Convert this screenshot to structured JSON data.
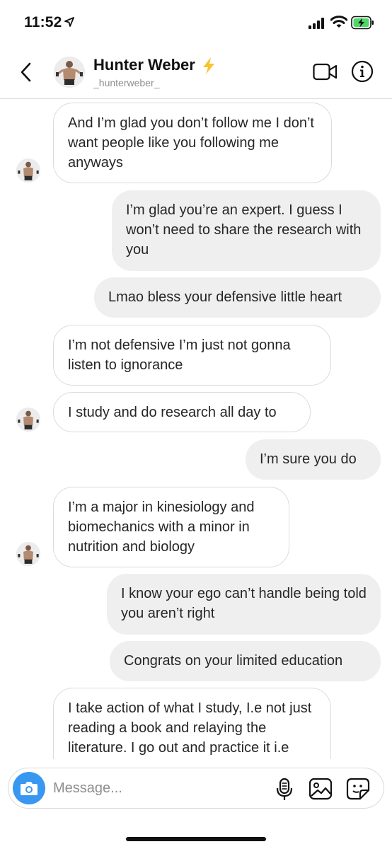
{
  "status_bar": {
    "time": "11:52"
  },
  "header": {
    "name": "Hunter Weber",
    "username": "_hunterweber_",
    "icons": [
      "back-chevron-icon",
      "bolt-icon",
      "video-camera-icon",
      "info-icon"
    ]
  },
  "messages": [
    {
      "from": "them",
      "text": "And I’m glad you don’t follow me I don’t want people like you following me anyways"
    },
    {
      "from": "me",
      "text": "I’m glad you’re an expert. I guess I won’t need to share the research with you"
    },
    {
      "from": "me",
      "text": "Lmao bless your defensive little heart"
    },
    {
      "from": "them",
      "text": "I’m not defensive I’m just not gonna listen to ignorance"
    },
    {
      "from": "them",
      "text": "I study and do research all day to"
    },
    {
      "from": "me",
      "text": "I’m sure you do"
    },
    {
      "from": "them",
      "text": "I’m a major in kinesiology and biomechanics with a minor in nutrition and biology"
    },
    {
      "from": "me",
      "text": "I know your ego can’t handle being told you aren’t right"
    },
    {
      "from": "me",
      "text": "Congrats on your limited education"
    },
    {
      "from": "them",
      "text": "I take action of what I study, I.e not just reading a book and relaying the literature. I go out and practice it i.e"
    }
  ],
  "composer": {
    "placeholder": "Message...",
    "icons": [
      "camera-icon",
      "microphone-icon",
      "gallery-icon",
      "sticker-icon"
    ]
  },
  "colors": {
    "accent": "#3897f0",
    "bolt": "#f7c330",
    "outgoing_bubble": "#efefef",
    "border": "#dbdbdb"
  }
}
